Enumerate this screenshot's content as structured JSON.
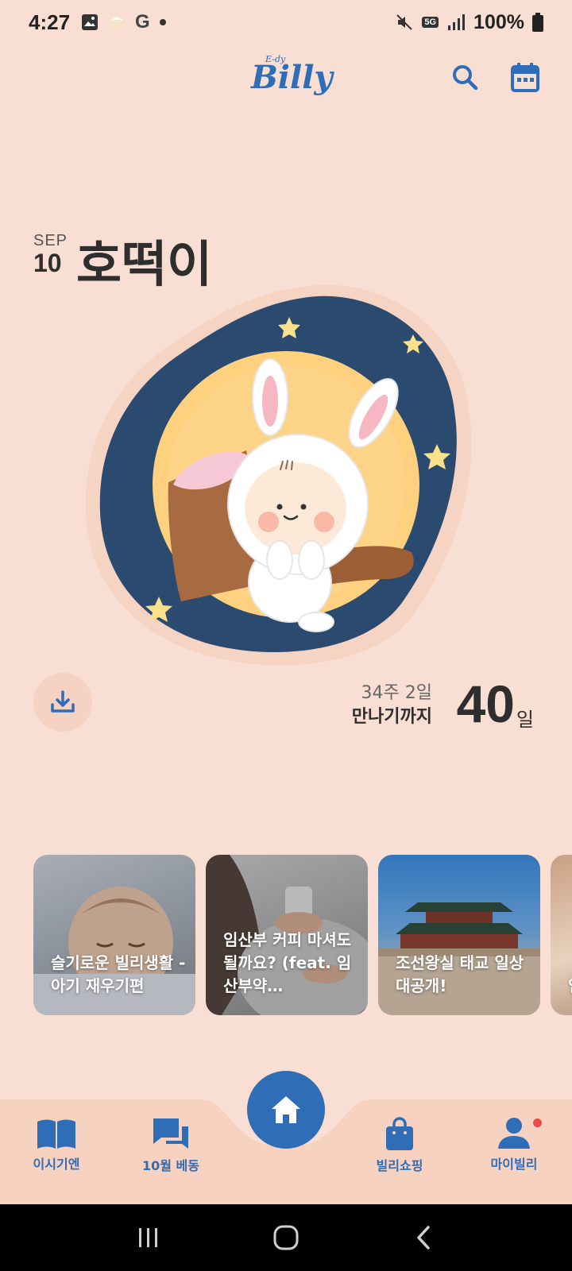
{
  "status_bar": {
    "time": "4:27",
    "network": "5G",
    "battery": "100%",
    "google_glyph": "G"
  },
  "header": {
    "logo_small": "E-dy",
    "logo_big": "Billy",
    "search_icon": "search-icon",
    "calendar_icon": "calendar-icon"
  },
  "baby": {
    "month": "SEP",
    "day": "10",
    "name": "호떡이"
  },
  "countdown": {
    "weeks": "34주 2일",
    "until": "만나기까지",
    "days": "40",
    "unit": "일"
  },
  "cards": [
    {
      "title": "슬기로운 빌리생활 - 아기 재우기편"
    },
    {
      "title": "임산부 커피 마셔도 될까요? (feat. 임산부약…"
    },
    {
      "title": "조선왕실 태교 일상 대공개!"
    },
    {
      "title": "임"
    }
  ],
  "bottom_nav": {
    "items": [
      {
        "label": "이시기엔",
        "icon": "book-icon"
      },
      {
        "label": "10월 베동",
        "icon": "chat-icon"
      },
      {
        "label": "",
        "icon": "home-icon"
      },
      {
        "label": "빌리쇼핑",
        "icon": "shopping-bag-icon"
      },
      {
        "label": "마이빌리",
        "icon": "person-icon"
      }
    ]
  },
  "colors": {
    "background": "#f9dfd3",
    "accent": "#2f6db6",
    "badge": "#ee4a4a"
  }
}
